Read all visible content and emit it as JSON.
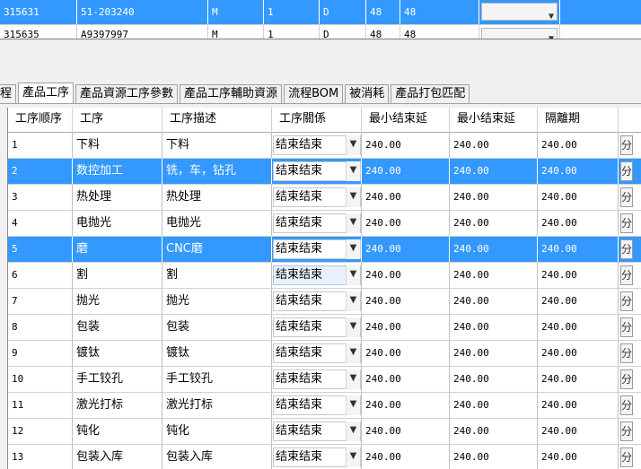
{
  "top_grid": {
    "rows": [
      {
        "c1": "315631",
        "c2": "51-203240",
        "c3": "M",
        "c4": "1",
        "c5": "D",
        "c6": "48",
        "c7": "48",
        "selected": true
      },
      {
        "c1": "315635",
        "c2": "A9397997",
        "c3": "M",
        "c4": "1",
        "c5": "D",
        "c6": "48",
        "c7": "48",
        "selected": false
      }
    ],
    "dropdown_arrow": "chevron-down-icon"
  },
  "tabs": {
    "partial_label": "程",
    "items": [
      {
        "label": "產品工序",
        "active": true
      },
      {
        "label": "產品資源工序參數",
        "active": false
      },
      {
        "label": "產品工序輔助資源",
        "active": false
      },
      {
        "label": "流程BOM",
        "active": false
      },
      {
        "label": "被消耗",
        "active": false
      },
      {
        "label": "產品打包匹配",
        "active": false
      }
    ]
  },
  "grid": {
    "headers": [
      "工序顺序",
      "工序",
      "工序描述",
      "工序關係",
      "最小结束延",
      "最小结束延",
      "隔離期"
    ],
    "rows": [
      {
        "seq": "1",
        "op": "下料",
        "desc": "下料",
        "rel": "结束结束",
        "a": "240.00",
        "b": "240.00",
        "c": "240.00",
        "selected": false
      },
      {
        "seq": "2",
        "op": "数控加工",
        "desc": "铣，车，钻孔",
        "rel": "结束结束",
        "a": "240.00",
        "b": "240.00",
        "c": "240.00",
        "selected": true
      },
      {
        "seq": "3",
        "op": "热处理",
        "desc": "热处理",
        "rel": "结束结束",
        "a": "240.00",
        "b": "240.00",
        "c": "240.00",
        "selected": false
      },
      {
        "seq": "4",
        "op": "电抛光",
        "desc": "电抛光",
        "rel": "结束结束",
        "a": "240.00",
        "b": "240.00",
        "c": "240.00",
        "selected": false
      },
      {
        "seq": "5",
        "op": "磨",
        "desc": "CNC磨",
        "rel": "结束结束",
        "a": "240.00",
        "b": "240.00",
        "c": "240.00",
        "selected": true
      },
      {
        "seq": "6",
        "op": "割",
        "desc": "割",
        "rel": "结束结束",
        "a": "240.00",
        "b": "240.00",
        "c": "240.00",
        "selected": false,
        "focused": true
      },
      {
        "seq": "7",
        "op": "抛光",
        "desc": "抛光",
        "rel": "结束结束",
        "a": "240.00",
        "b": "240.00",
        "c": "240.00",
        "selected": false
      },
      {
        "seq": "8",
        "op": "包装",
        "desc": "包装",
        "rel": "结束结束",
        "a": "240.00",
        "b": "240.00",
        "c": "240.00",
        "selected": false
      },
      {
        "seq": "9",
        "op": "镀钛",
        "desc": "镀钛",
        "rel": "结束结束",
        "a": "240.00",
        "b": "240.00",
        "c": "240.00",
        "selected": false
      },
      {
        "seq": "10",
        "op": "手工铰孔",
        "desc": "手工铰孔",
        "rel": "结束结束",
        "a": "240.00",
        "b": "240.00",
        "c": "240.00",
        "selected": false
      },
      {
        "seq": "11",
        "op": "激光打标",
        "desc": "激光打标",
        "rel": "结束结束",
        "a": "240.00",
        "b": "240.00",
        "c": "240.00",
        "selected": false
      },
      {
        "seq": "12",
        "op": "钝化",
        "desc": "钝化",
        "rel": "结束结束",
        "a": "240.00",
        "b": "240.00",
        "c": "240.00",
        "selected": false
      },
      {
        "seq": "13",
        "op": "包装入库",
        "desc": "包装入库",
        "rel": "结束结束",
        "a": "240.00",
        "b": "240.00",
        "c": "240.00",
        "selected": false
      }
    ],
    "edge_glyph": "分"
  },
  "colors": {
    "selection": "#3399ff",
    "background": "#f0f0f0"
  }
}
